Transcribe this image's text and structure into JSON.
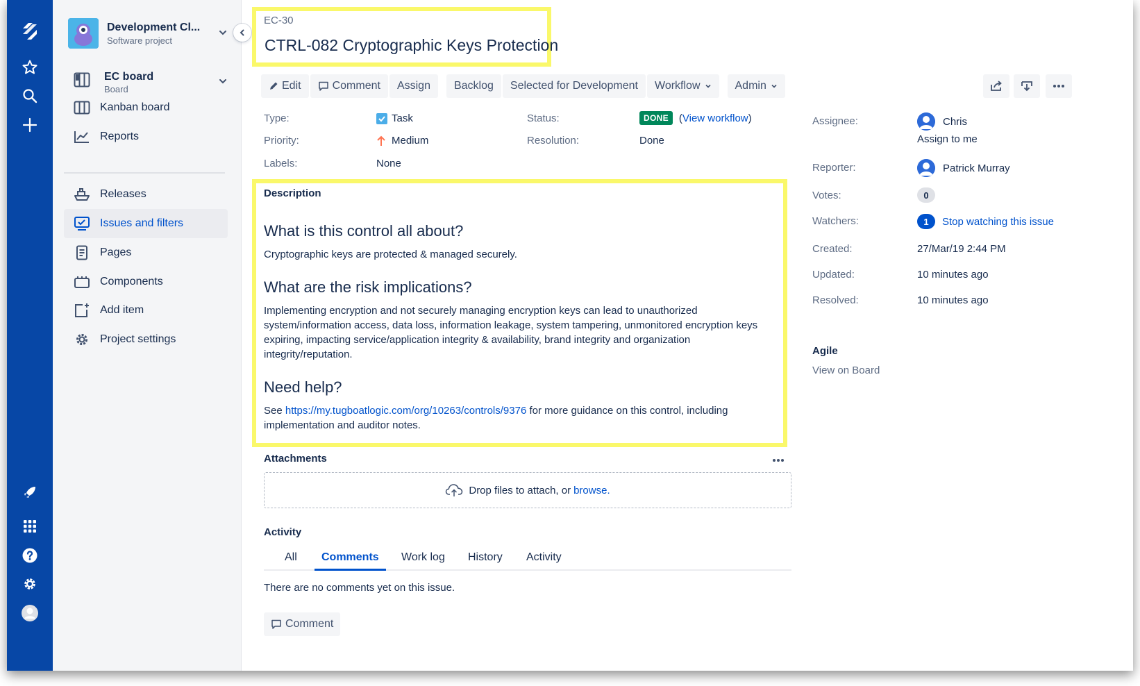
{
  "sidebar": {
    "project_name": "Development Cl...",
    "project_type": "Software project",
    "board_name": "EC board",
    "board_sub": "Board",
    "items": [
      {
        "label": "Kanban board"
      },
      {
        "label": "Reports"
      },
      {
        "label": "Releases"
      },
      {
        "label": "Issues and filters"
      },
      {
        "label": "Pages"
      },
      {
        "label": "Components"
      },
      {
        "label": "Add item"
      },
      {
        "label": "Project settings"
      }
    ]
  },
  "issue": {
    "key": "EC-30",
    "title": "CTRL-082 Cryptographic Keys Protection"
  },
  "toolbar": {
    "edit": "Edit",
    "comment": "Comment",
    "assign": "Assign",
    "backlog": "Backlog",
    "selected": "Selected for Development",
    "workflow": "Workflow",
    "admin": "Admin"
  },
  "details": {
    "type_label": "Type:",
    "type_value": "Task",
    "priority_label": "Priority:",
    "priority_value": "Medium",
    "labels_label": "Labels:",
    "labels_value": "None",
    "status_label": "Status:",
    "status_value": "DONE",
    "view_workflow": "View workflow",
    "resolution_label": "Resolution:",
    "resolution_value": "Done"
  },
  "description": {
    "heading": "Description",
    "h1": "What is this control all about?",
    "p1": "Cryptographic keys are protected & managed securely.",
    "h2": "What are the risk implications?",
    "p2": "Implementing encryption and not securely managing encryption keys can lead to unauthorized system/information access, data loss, information leakage, system tampering, unmonitored encryption keys expiring, impacting service/application integrity & availability, brand integrity and organization integrity/reputation.",
    "h3": "Need help?",
    "p3_pre": "See ",
    "p3_link": "https://my.tugboatlogic.com/org/10263/controls/9376",
    "p3_post": " for more guidance on this control, including implementation and auditor notes."
  },
  "attachments": {
    "title": "Attachments",
    "drop_text": "Drop files to attach, or ",
    "browse": "browse."
  },
  "activity": {
    "title": "Activity",
    "tabs": [
      "All",
      "Comments",
      "Work log",
      "History",
      "Activity"
    ],
    "active_tab": "Comments",
    "empty": "There are no comments yet on this issue.",
    "comment_button": "Comment"
  },
  "people": {
    "assignee_label": "Assignee:",
    "assignee": "Chris",
    "assign_to_me": "Assign to me",
    "reporter_label": "Reporter:",
    "reporter": "Patrick Murray",
    "votes_label": "Votes:",
    "votes": "0",
    "watchers_label": "Watchers:",
    "watchers": "1",
    "stop_watching": "Stop watching this issue",
    "created_label": "Created:",
    "created": "27/Mar/19 2:44 PM",
    "updated_label": "Updated:",
    "updated": "10 minutes ago",
    "resolved_label": "Resolved:",
    "resolved": "10 minutes ago"
  },
  "agile": {
    "title": "Agile",
    "view_on_board": "View on Board"
  },
  "colors": {
    "nav_blue": "#0747A6",
    "link_blue": "#0052CC",
    "done_green": "#00875A",
    "highlight_yellow": "#FAF86A"
  }
}
